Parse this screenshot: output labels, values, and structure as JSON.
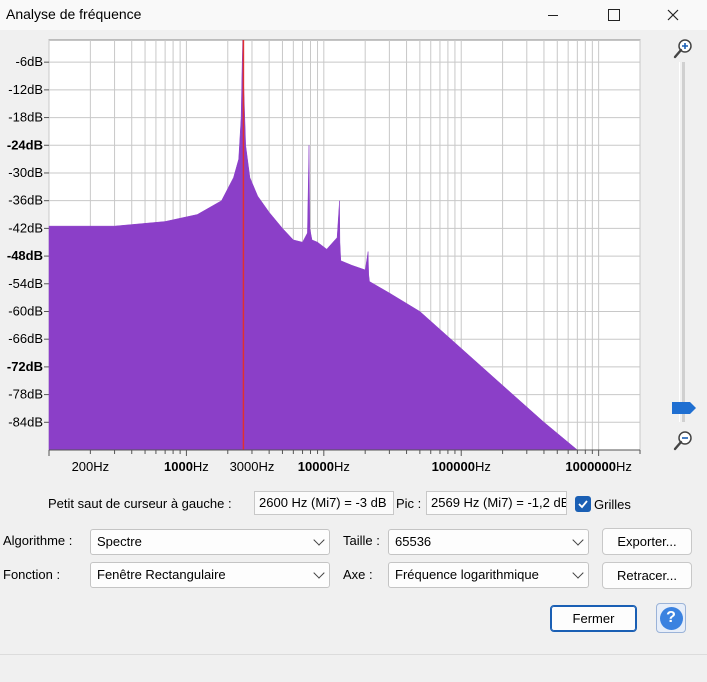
{
  "window": {
    "title": "Analyse de fréquence",
    "minimize_icon": "minimize-icon",
    "maximize_icon": "maximize-icon",
    "close_icon": "close-icon"
  },
  "plot": {
    "fill_color": "#8b3fc8",
    "cursor_color": "#e0302f",
    "grid_color": "#c8c8c8"
  },
  "chart_data": {
    "type": "area",
    "x_scale": "log",
    "xlim": [
      100,
      2000000
    ],
    "ylim": [
      -90,
      -1.2
    ],
    "y_ticks": [
      "-6dB",
      "-12dB",
      "-18dB",
      "-24dB",
      "-30dB",
      "-36dB",
      "-42dB",
      "-48dB",
      "-54dB",
      "-60dB",
      "-66dB",
      "-72dB",
      "-78dB",
      "-84dB"
    ],
    "y_tick_values": [
      -6,
      -12,
      -18,
      -24,
      -30,
      -36,
      -42,
      -48,
      -54,
      -60,
      -66,
      -72,
      -78,
      -84
    ],
    "x_ticks": [
      "200Hz",
      "1000Hz",
      "3000Hz",
      "10000Hz",
      "100000Hz",
      "1000000Hz"
    ],
    "x_tick_values": [
      200,
      1000,
      3000,
      10000,
      100000,
      1000000
    ],
    "cursor_x": 2600,
    "series": [
      {
        "x": [
          100,
          300,
          700,
          1200,
          1800,
          2200,
          2400,
          2500,
          2540,
          2569,
          2600,
          2700,
          2900,
          3300,
          4000,
          5000,
          6000,
          7000,
          7600,
          7800,
          7900,
          8200,
          9000,
          10500,
          12500,
          13000,
          13100,
          13300,
          16000,
          20000,
          21000,
          21200,
          21500,
          30000,
          50000,
          100000,
          200000,
          400000,
          700000
        ],
        "y": [
          -41.5,
          -41.5,
          -40.5,
          -39,
          -36,
          -31,
          -27,
          -18,
          -8,
          -1.2,
          -9,
          -24,
          -31,
          -35,
          -38.5,
          -42,
          -44.5,
          -45,
          -43,
          -24,
          -42,
          -44.5,
          -45,
          -46.5,
          -44,
          -36,
          -45,
          -49,
          -50,
          -51,
          -47,
          -52,
          -53.5,
          -56,
          -60,
          -68,
          -76,
          -84,
          -90
        ]
      }
    ]
  },
  "zoom": {
    "in_icon": "zoom-in-icon",
    "out_icon": "zoom-out-icon"
  },
  "cursor_row": {
    "label": "Petit saut de curseur à gauche :",
    "cursor_value": "2600 Hz (Mi7) = -3 dB",
    "peak_label": "Pic :",
    "peak_value": "2569 Hz (Mi7) = -1,2 dB",
    "grids_label": "Grilles",
    "grids_checked": true
  },
  "controls": {
    "algorithm_label": "Algorithme :",
    "algorithm_value": "Spectre",
    "size_label": "Taille :",
    "size_value": "65536",
    "export_label": "Exporter...",
    "function_label": "Fonction :",
    "function_value": "Fenêtre Rectangulaire",
    "axis_label": "Axe :",
    "axis_value": "Fréquence logarithmique",
    "replot_label": "Retracer...",
    "close_label": "Fermer",
    "help_label": "?"
  }
}
